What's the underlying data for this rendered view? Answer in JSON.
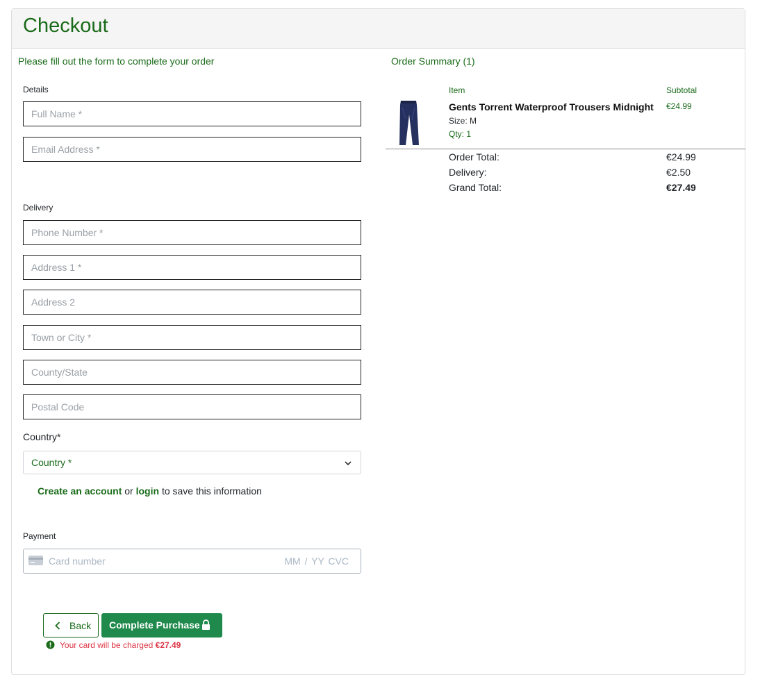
{
  "header": {
    "title": "Checkout"
  },
  "form": {
    "intro": "Please fill out the form to complete your order",
    "details_label": "Details",
    "full_name_placeholder": "Full Name *",
    "email_placeholder": "Email Address *",
    "delivery_label": "Delivery",
    "phone_placeholder": "Phone Number *",
    "address1_placeholder": "Address 1 *",
    "address2_placeholder": "Address 2",
    "town_placeholder": "Town or City *",
    "county_placeholder": "County/State",
    "postcode_placeholder": "Postal Code",
    "country_label": "Country*",
    "country_value": "Country *",
    "account_link": "Create an account",
    "or_text": "or",
    "login_link": "login",
    "account_suffix": "to save this information",
    "payment_label": "Payment",
    "card_placeholder": "Card number",
    "card_exp_cvc": "MM / YY  CVC",
    "back_label": "Back",
    "complete_label": "Complete Purchase",
    "charge_text": "Your card will be charged",
    "charge_amount": "€27.49"
  },
  "summary": {
    "title": "Order Summary (1)",
    "item_header": "Item",
    "subtotal_header": "Subtotal",
    "items": [
      {
        "name": "Gents Torrent Waterproof Trousers Midnight",
        "size": "Size: M",
        "qty": "Qty: 1",
        "price": "€24.99"
      }
    ],
    "order_total_label": "Order Total:",
    "order_total": "€24.99",
    "delivery_label": "Delivery:",
    "delivery": "€2.50",
    "grand_total_label": "Grand Total:",
    "grand_total": "€27.49"
  },
  "colors": {
    "accent": "#1a6b1a",
    "button": "#1f8a4c",
    "error": "#dc3545"
  }
}
